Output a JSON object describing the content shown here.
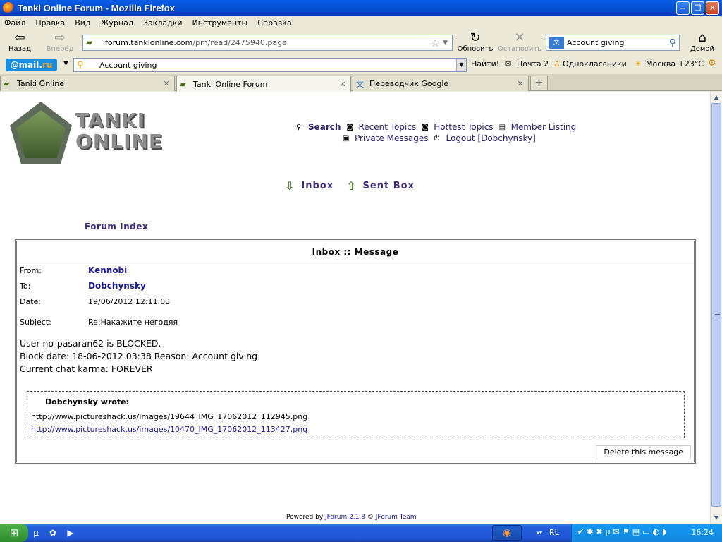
{
  "window": {
    "title": "Tanki Online Forum - Mozilla Firefox",
    "min_glyph": "‒",
    "max_glyph": "❐",
    "close_glyph": "✕"
  },
  "menu": [
    "Файл",
    "Правка",
    "Вид",
    "Журнал",
    "Закладки",
    "Инструменты",
    "Справка"
  ],
  "toolbar": {
    "back": "Назад",
    "forward": "Вперёд",
    "reload": "Обновить",
    "stop": "Остановить",
    "home": "Домой",
    "url_domain": "forum.tankionline.com",
    "url_path": "/pm/read/2475940.page",
    "search_value": "Account giving"
  },
  "mailbar": {
    "logo_prefix": "@mail.",
    "logo_suffix": "ru",
    "search_value": "Account giving",
    "find": "Найти!",
    "mail": "Почта 2",
    "ok": "Одноклассники",
    "weather": "Москва +23°C"
  },
  "tabs": [
    {
      "title": "Tanki Online"
    },
    {
      "title": "Tanki Online Forum"
    },
    {
      "title": "Переводчик Google"
    }
  ],
  "forum": {
    "logo_line1": "TANKI",
    "logo_line2": "ONLINE",
    "nav": {
      "search": "Search",
      "recent": "Recent Topics",
      "hottest": "Hottest Topics",
      "members": "Member Listing",
      "pm": "Private Messages",
      "logout": "Logout [Dobchynsky]"
    },
    "inbox": "Inbox",
    "sentbox": "Sent Box",
    "forum_index": "Forum Index"
  },
  "message": {
    "header": "Inbox :: Message",
    "from_label": "From:",
    "from": "Kennobi",
    "to_label": "To:",
    "to": "Dobchynsky",
    "date_label": "Date:",
    "date": "19/06/2012 12:11:03",
    "subject_label": "Subject:",
    "subject": "Re:Накажите негодяя",
    "body": [
      "User no-pasaran62 is BLOCKED.",
      "Block date: 18-06-2012 03:38 Reason: Account giving",
      "Current chat karma: FOREVER"
    ],
    "quote_author": "Dobchynsky wrote:",
    "quote_lines": [
      "http://www.pictureshack.us/images/19644_IMG_17062012_112945.png",
      "http://www.pictureshack.us/images/10470_IMG_17062012_113427.png"
    ],
    "delete": "Delete this message"
  },
  "footer": {
    "powered_prefix": "Powered by ",
    "jforum": "JForum 2.1.8",
    "copy": " © ",
    "team": "JForum Team"
  },
  "taskbar": {
    "lang": "RL",
    "clock": "16:24"
  }
}
